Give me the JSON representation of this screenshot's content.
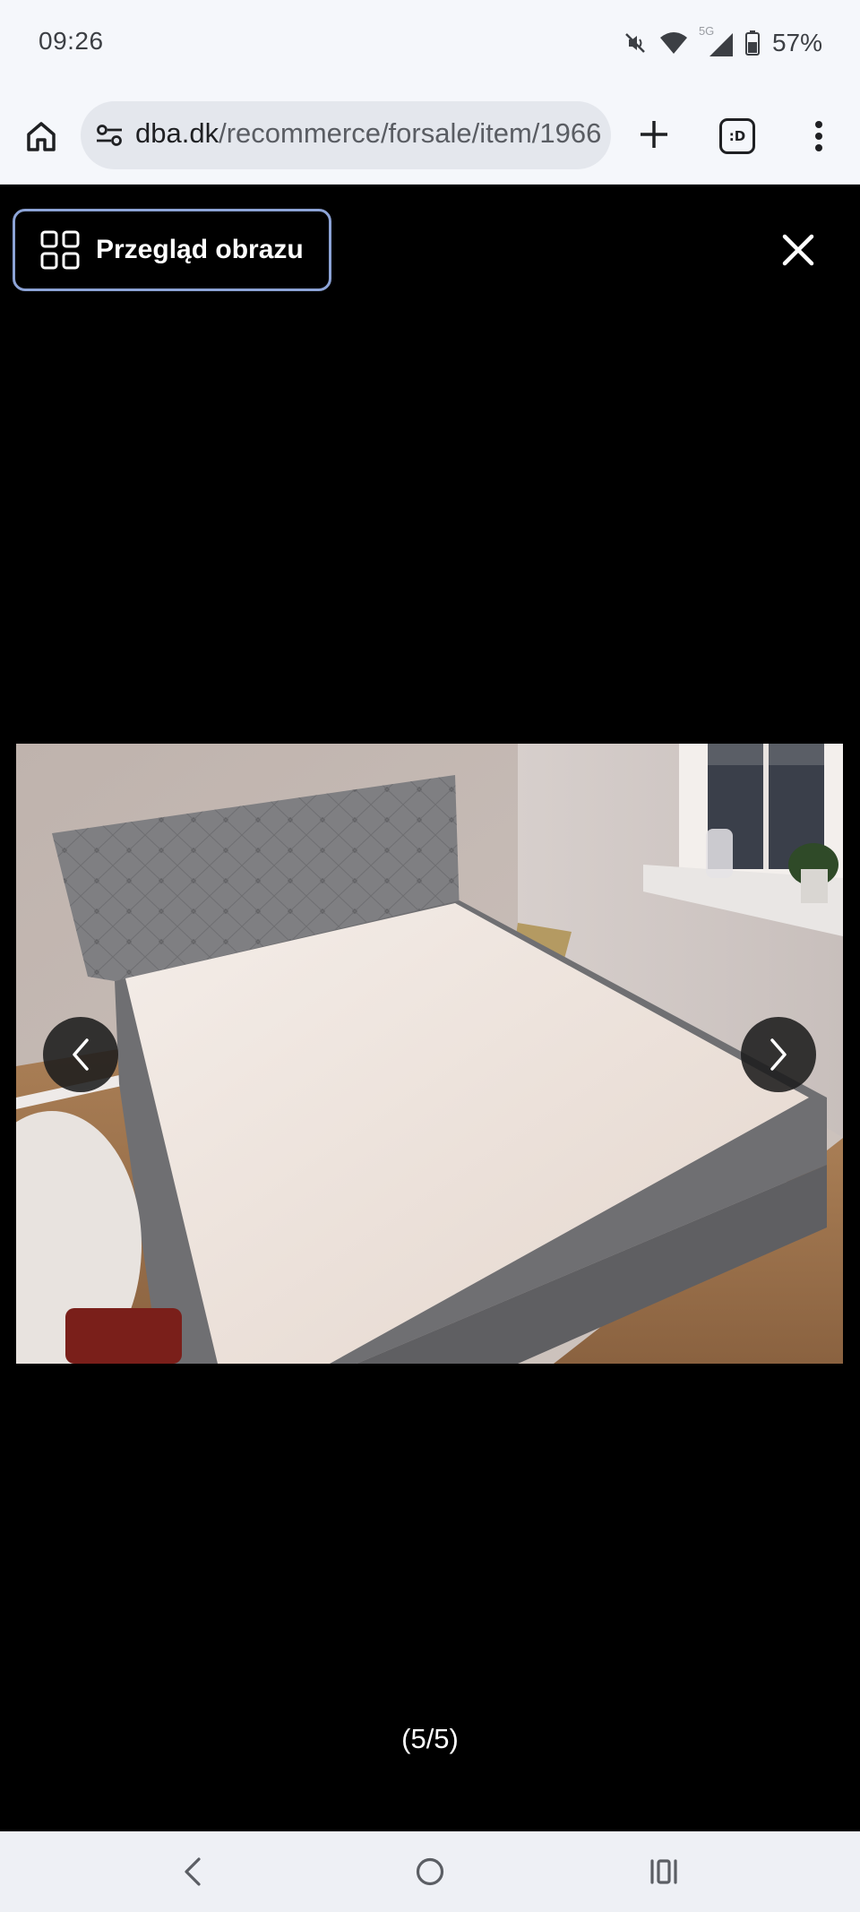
{
  "status_bar": {
    "time": "09:26",
    "network_label": "5G",
    "battery": "57%",
    "icons": [
      "mute-vibrate-icon",
      "wifi-icon",
      "signal-icon",
      "battery-icon"
    ]
  },
  "browser": {
    "url_host": "dba.dk",
    "url_path": "/recommerce/forsale/item/1966",
    "tabs_badge": ":D",
    "icons": [
      "home-icon",
      "site-settings-icon",
      "plus-icon",
      "tabs-icon",
      "overflow-menu-icon"
    ]
  },
  "viewer": {
    "overview_label": "Przegląd obrazu",
    "counter": "(5/5)",
    "current_index": 5,
    "total_images": 5,
    "icons": [
      "grid-icon",
      "close-icon",
      "chevron-left-icon",
      "chevron-right-icon"
    ]
  },
  "system_nav": {
    "icons": [
      "back-icon",
      "home-circle-icon",
      "recents-icon"
    ]
  }
}
